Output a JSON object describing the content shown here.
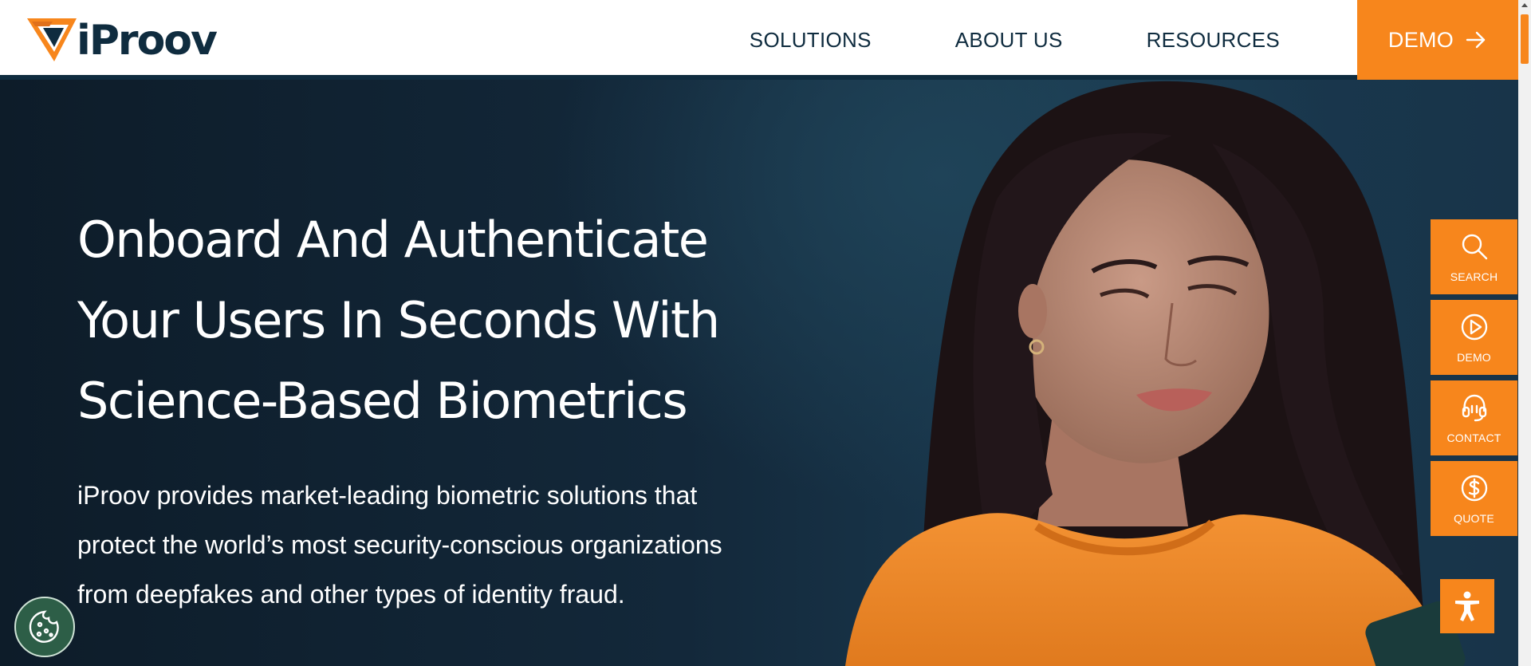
{
  "brand": {
    "name": "iProov",
    "accent_color": "#f7861c",
    "navy": "#0f2c3f"
  },
  "nav": {
    "items": [
      {
        "label": "SOLUTIONS"
      },
      {
        "label": "ABOUT US"
      },
      {
        "label": "RESOURCES"
      }
    ],
    "demo_label": "DEMO",
    "demo_icon": "arrow-right-icon"
  },
  "hero": {
    "title": "Onboard And Authenticate Your Users In Seconds With Science-Based Biometrics",
    "body": "iProov provides market-leading biometric solutions that protect the world’s most security-conscious organizations from deepfakes and other types of identity fraud."
  },
  "side_tools": [
    {
      "label": "SEARCH",
      "icon": "search-icon"
    },
    {
      "label": "DEMO",
      "icon": "play-icon"
    },
    {
      "label": "CONTACT",
      "icon": "headset-icon"
    },
    {
      "label": "QUOTE",
      "icon": "dollar-icon"
    }
  ],
  "widgets": {
    "accessibility_icon": "accessibility-icon",
    "cookie_icon": "cookie-icon"
  }
}
